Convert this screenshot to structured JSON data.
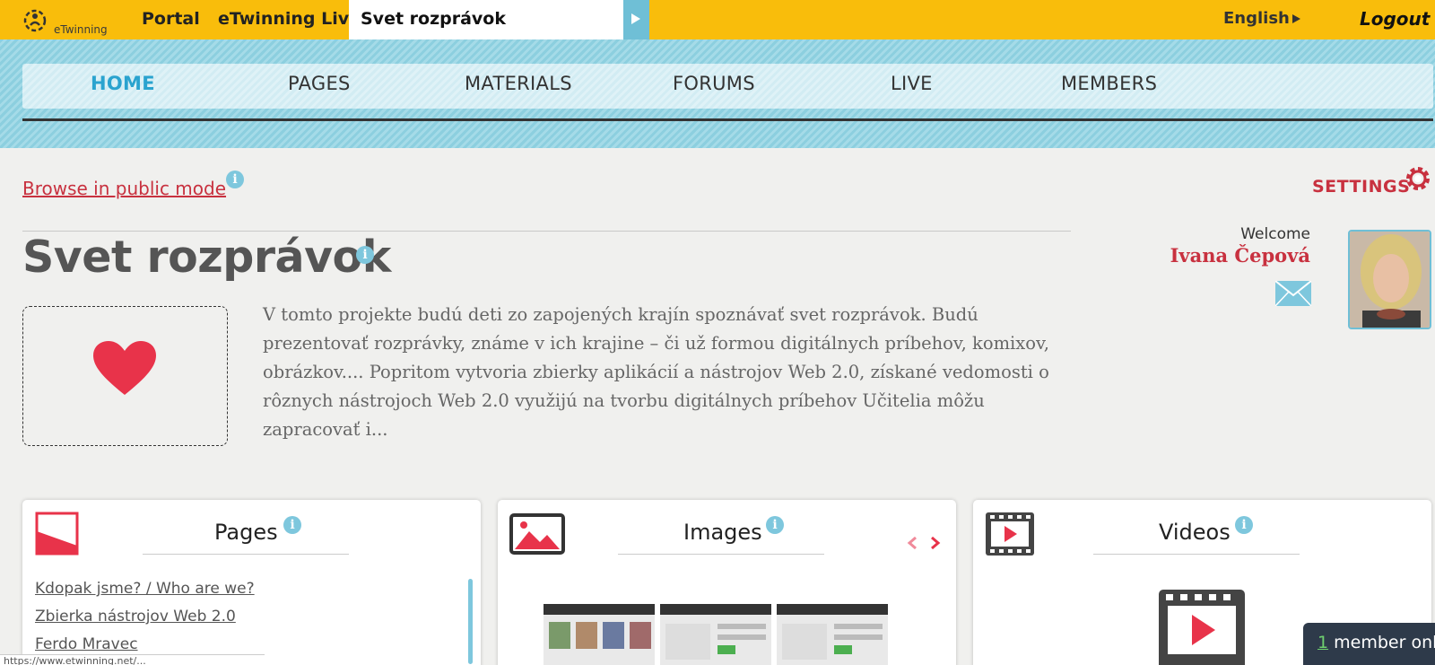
{
  "topbar": {
    "logo_text": "eTwinning",
    "portal": "Portal",
    "live": "eTwinning Live",
    "project_tab": "Svet rozprávok",
    "language": "English",
    "logout": "Logout"
  },
  "nav": {
    "items": [
      {
        "label": "HOME",
        "active": true
      },
      {
        "label": "PAGES"
      },
      {
        "label": "MATERIALS"
      },
      {
        "label": "FORUMS"
      },
      {
        "label": "LIVE"
      },
      {
        "label": "MEMBERS"
      }
    ]
  },
  "header": {
    "public_mode": "Browse in public mode",
    "settings": "SETTINGS",
    "title": "Svet rozprávok",
    "welcome": "Welcome",
    "username": "Ivana Čepová"
  },
  "description": "V tomto projekte budú deti zo zapojených krajín spoznávať svet rozprávok. Budú prezentovať rozprávky, známe v ich krajine – či už formou digitálnych príbehov, komixov, obrázkov.... Popritom vytvoria zbierky aplikácií a nástrojov Web 2.0, získané vedomosti o rôznych nástrojoch Web 2.0 využijú na tvorbu digitálnych príbehov Učitelia môžu zapracovať i...",
  "cards": {
    "pages": {
      "title": "Pages",
      "links": [
        "Kdopak jsme? / Who are we?",
        "Zbierka nástrojov Web 2.0",
        "Ferdo Mravec"
      ]
    },
    "images": {
      "title": "Images"
    },
    "videos": {
      "title": "Videos"
    }
  },
  "status_bar": "https://www.etwinning.net/...",
  "online": {
    "count": "1",
    "label": " member onl"
  },
  "colors": {
    "topbar": "#f9bd0b",
    "accent_red": "#c8313f",
    "accent_blue": "#2aa3cf"
  }
}
